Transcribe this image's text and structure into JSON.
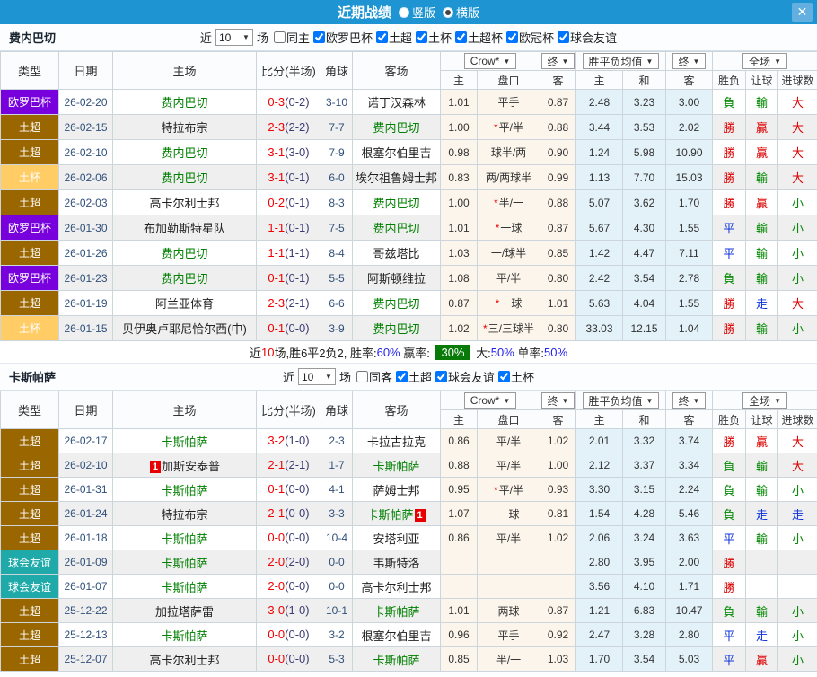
{
  "icons": {
    "dropdown_arrow": "▼",
    "close": "✕"
  },
  "titlebar": {
    "title": "近期战绩",
    "layout_options": [
      {
        "label": "竖版",
        "selected": false
      },
      {
        "label": "横版",
        "selected": true
      }
    ]
  },
  "columns": {
    "type": "类型",
    "date": "日期",
    "home": "主场",
    "score": "比分(半场)",
    "corner": "角球",
    "away": "客场",
    "dd_crown": "Crow*",
    "dd_final1": "终",
    "dd_avg": "胜平负均值",
    "dd_final2": "终",
    "dd_fullmatch": "全场",
    "sub_home": "主",
    "sub_line": "盘口",
    "sub_away": "客",
    "sub_avg_home": "主",
    "sub_avg_draw": "和",
    "sub_avg_away": "客",
    "sub_outcome": "胜负",
    "sub_handicap": "让球",
    "sub_goals": "进球数"
  },
  "league_colors": {
    "欧罗巴杯": "#7700DD",
    "土超": "#996600",
    "土杯": "#FFCC66",
    "球会友谊": "#1FA9A9",
    "欧冠杯": "#7700DD"
  },
  "result_colors": {
    "勝": "#DD0000",
    "贏": "#DD0000",
    "大": "#DD0000",
    "負": "#008800",
    "輸": "#008800",
    "小": "#008800",
    "平": "#1133DD",
    "走": "#1133DD"
  },
  "sections": [
    {
      "team": "费内巴切",
      "filter": {
        "near": "近",
        "count": "10",
        "unit": "场",
        "same": "同主",
        "same_checked": false,
        "leagues": [
          "欧罗巴杯",
          "土超",
          "土杯",
          "土超杯",
          "欧冠杯",
          "球会友谊"
        ]
      },
      "rows": [
        {
          "league": "欧罗巴杯",
          "date": "26-02-20",
          "home": "费内巴切",
          "home_focus": true,
          "score": "0-3",
          "half": "(0-2)",
          "corners": "3-10",
          "away": "诺丁汉森林",
          "away_focus": false,
          "ah_home": "1.01",
          "ah_star": false,
          "ah_line": "平手",
          "ah_away": "0.87",
          "avg_home": "2.48",
          "avg_draw": "3.23",
          "avg_away": "3.00",
          "outcome": "負",
          "ah_result": "輸",
          "goals_result": "大"
        },
        {
          "league": "土超",
          "date": "26-02-15",
          "home": "特拉布宗",
          "home_focus": false,
          "score": "2-3",
          "half": "(2-2)",
          "corners": "7-7",
          "away": "费内巴切",
          "away_focus": true,
          "ah_home": "1.00",
          "ah_star": true,
          "ah_line": "平/半",
          "ah_away": "0.88",
          "avg_home": "3.44",
          "avg_draw": "3.53",
          "avg_away": "2.02",
          "outcome": "勝",
          "ah_result": "贏",
          "goals_result": "大"
        },
        {
          "league": "土超",
          "date": "26-02-10",
          "home": "费内巴切",
          "home_focus": true,
          "score": "3-1",
          "half": "(3-0)",
          "corners": "7-9",
          "away": "根塞尔伯里吉",
          "away_focus": false,
          "ah_home": "0.98",
          "ah_star": false,
          "ah_line": "球半/两",
          "ah_away": "0.90",
          "avg_home": "1.24",
          "avg_draw": "5.98",
          "avg_away": "10.90",
          "outcome": "勝",
          "ah_result": "贏",
          "goals_result": "大"
        },
        {
          "league": "土杯",
          "date": "26-02-06",
          "home": "费内巴切",
          "home_focus": true,
          "score": "3-1",
          "half": "(0-1)",
          "corners": "6-0",
          "away": "埃尔祖鲁姆士邦",
          "away_focus": false,
          "ah_home": "0.83",
          "ah_star": false,
          "ah_line": "两/两球半",
          "ah_away": "0.99",
          "avg_home": "1.13",
          "avg_draw": "7.70",
          "avg_away": "15.03",
          "outcome": "勝",
          "ah_result": "輸",
          "goals_result": "大"
        },
        {
          "league": "土超",
          "date": "26-02-03",
          "home": "高卡尔利士邦",
          "home_focus": false,
          "score": "0-2",
          "half": "(0-1)",
          "corners": "8-3",
          "away": "费内巴切",
          "away_focus": true,
          "ah_home": "1.00",
          "ah_star": true,
          "ah_line": "半/一",
          "ah_away": "0.88",
          "avg_home": "5.07",
          "avg_draw": "3.62",
          "avg_away": "1.70",
          "outcome": "勝",
          "ah_result": "贏",
          "goals_result": "小"
        },
        {
          "league": "欧罗巴杯",
          "date": "26-01-30",
          "home": "布加勒斯特星队",
          "home_focus": false,
          "score": "1-1",
          "half": "(0-1)",
          "corners": "7-5",
          "away": "费内巴切",
          "away_focus": true,
          "ah_home": "1.01",
          "ah_star": true,
          "ah_line": "一球",
          "ah_away": "0.87",
          "avg_home": "5.67",
          "avg_draw": "4.30",
          "avg_away": "1.55",
          "outcome": "平",
          "ah_result": "輸",
          "goals_result": "小"
        },
        {
          "league": "土超",
          "date": "26-01-26",
          "home": "费内巴切",
          "home_focus": true,
          "score": "1-1",
          "half": "(1-1)",
          "corners": "8-4",
          "away": "哥兹塔比",
          "away_focus": false,
          "ah_home": "1.03",
          "ah_star": false,
          "ah_line": "一/球半",
          "ah_away": "0.85",
          "avg_home": "1.42",
          "avg_draw": "4.47",
          "avg_away": "7.11",
          "outcome": "平",
          "ah_result": "輸",
          "goals_result": "小"
        },
        {
          "league": "欧罗巴杯",
          "date": "26-01-23",
          "home": "费内巴切",
          "home_focus": true,
          "score": "0-1",
          "half": "(0-1)",
          "corners": "5-5",
          "away": "阿斯顿维拉",
          "away_focus": false,
          "ah_home": "1.08",
          "ah_star": false,
          "ah_line": "平/半",
          "ah_away": "0.80",
          "avg_home": "2.42",
          "avg_draw": "3.54",
          "avg_away": "2.78",
          "outcome": "負",
          "ah_result": "輸",
          "goals_result": "小"
        },
        {
          "league": "土超",
          "date": "26-01-19",
          "home": "阿兰亚体育",
          "home_focus": false,
          "score": "2-3",
          "half": "(2-1)",
          "corners": "6-6",
          "away": "费内巴切",
          "away_focus": true,
          "ah_home": "0.87",
          "ah_star": true,
          "ah_line": "一球",
          "ah_away": "1.01",
          "avg_home": "5.63",
          "avg_draw": "4.04",
          "avg_away": "1.55",
          "outcome": "勝",
          "ah_result": "走",
          "goals_result": "大"
        },
        {
          "league": "土杯",
          "date": "26-01-15",
          "home": "贝伊奥卢耶尼恰尔西(中)",
          "home_focus": false,
          "score": "0-1",
          "half": "(0-0)",
          "corners": "3-9",
          "away": "费内巴切",
          "away_focus": true,
          "ah_home": "1.02",
          "ah_star": true,
          "ah_line": "三/三球半",
          "ah_away": "0.80",
          "avg_home": "33.03",
          "avg_draw": "12.15",
          "avg_away": "1.04",
          "outcome": "勝",
          "ah_result": "輸",
          "goals_result": "小"
        }
      ],
      "summary": {
        "segments": [
          {
            "text": "近",
            "style": "dark"
          },
          {
            "text": "10",
            "style": "red"
          },
          {
            "text": "场,胜6平2负2, 胜率:",
            "style": "dark"
          },
          {
            "text": "60%",
            "style": "blue"
          },
          {
            "text": " 赢率: ",
            "style": "dark"
          },
          {
            "text": "30%",
            "style": "badge"
          },
          {
            "text": " 大:",
            "style": "dark"
          },
          {
            "text": "50%",
            "style": "blue"
          },
          {
            "text": " 单率:",
            "style": "dark"
          },
          {
            "text": "50%",
            "style": "blue"
          }
        ]
      }
    },
    {
      "team": "卡斯帕萨",
      "filter": {
        "near": "近",
        "count": "10",
        "unit": "场",
        "same": "同客",
        "same_checked": false,
        "leagues": [
          "土超",
          "球会友谊",
          "土杯"
        ]
      },
      "rows": [
        {
          "league": "土超",
          "date": "26-02-17",
          "home": "卡斯帕萨",
          "home_focus": true,
          "score": "3-2",
          "half": "(1-0)",
          "corners": "2-3",
          "away": "卡拉古拉克",
          "away_focus": false,
          "ah_home": "0.86",
          "ah_star": false,
          "ah_line": "平/半",
          "ah_away": "1.02",
          "avg_home": "2.01",
          "avg_draw": "3.32",
          "avg_away": "3.74",
          "outcome": "勝",
          "ah_result": "贏",
          "goals_result": "大"
        },
        {
          "league": "土超",
          "date": "26-02-10",
          "home": "加斯安泰普",
          "home_focus": false,
          "home_badge_pre": "1",
          "score": "2-1",
          "half": "(2-1)",
          "corners": "1-7",
          "away": "卡斯帕萨",
          "away_focus": true,
          "ah_home": "0.88",
          "ah_star": false,
          "ah_line": "平/半",
          "ah_away": "1.00",
          "avg_home": "2.12",
          "avg_draw": "3.37",
          "avg_away": "3.34",
          "outcome": "負",
          "ah_result": "輸",
          "goals_result": "大"
        },
        {
          "league": "土超",
          "date": "26-01-31",
          "home": "卡斯帕萨",
          "home_focus": true,
          "score": "0-1",
          "half": "(0-0)",
          "corners": "4-1",
          "away": "萨姆士邦",
          "away_focus": false,
          "ah_home": "0.95",
          "ah_star": true,
          "ah_line": "平/半",
          "ah_away": "0.93",
          "avg_home": "3.30",
          "avg_draw": "3.15",
          "avg_away": "2.24",
          "outcome": "負",
          "ah_result": "輸",
          "goals_result": "小"
        },
        {
          "league": "土超",
          "date": "26-01-24",
          "home": "特拉布宗",
          "home_focus": false,
          "score": "2-1",
          "half": "(0-0)",
          "corners": "3-3",
          "away": "卡斯帕萨",
          "away_focus": true,
          "away_badge_post": "1",
          "ah_home": "1.07",
          "ah_star": false,
          "ah_line": "一球",
          "ah_away": "0.81",
          "avg_home": "1.54",
          "avg_draw": "4.28",
          "avg_away": "5.46",
          "outcome": "負",
          "ah_result": "走",
          "goals_result": "走"
        },
        {
          "league": "土超",
          "date": "26-01-18",
          "home": "卡斯帕萨",
          "home_focus": true,
          "score": "0-0",
          "half": "(0-0)",
          "corners": "10-4",
          "away": "安塔利亚",
          "away_focus": false,
          "ah_home": "0.86",
          "ah_star": false,
          "ah_line": "平/半",
          "ah_away": "1.02",
          "avg_home": "2.06",
          "avg_draw": "3.24",
          "avg_away": "3.63",
          "outcome": "平",
          "ah_result": "輸",
          "goals_result": "小"
        },
        {
          "league": "球会友谊",
          "date": "26-01-09",
          "home": "卡斯帕萨",
          "home_focus": true,
          "score": "2-0",
          "half": "(2-0)",
          "corners": "0-0",
          "away": "韦斯特洛",
          "away_focus": false,
          "ah_home": "",
          "ah_star": false,
          "ah_line": "",
          "ah_away": "",
          "avg_home": "2.80",
          "avg_draw": "3.95",
          "avg_away": "2.00",
          "outcome": "勝",
          "ah_result": "",
          "goals_result": ""
        },
        {
          "league": "球会友谊",
          "date": "26-01-07",
          "home": "卡斯帕萨",
          "home_focus": true,
          "score": "2-0",
          "half": "(0-0)",
          "corners": "0-0",
          "away": "高卡尔利士邦",
          "away_focus": false,
          "ah_home": "",
          "ah_star": false,
          "ah_line": "",
          "ah_away": "",
          "avg_home": "3.56",
          "avg_draw": "4.10",
          "avg_away": "1.71",
          "outcome": "勝",
          "ah_result": "",
          "goals_result": ""
        },
        {
          "league": "土超",
          "date": "25-12-22",
          "home": "加拉塔萨雷",
          "home_focus": false,
          "score": "3-0",
          "half": "(1-0)",
          "corners": "10-1",
          "away": "卡斯帕萨",
          "away_focus": true,
          "ah_home": "1.01",
          "ah_star": false,
          "ah_line": "两球",
          "ah_away": "0.87",
          "avg_home": "1.21",
          "avg_draw": "6.83",
          "avg_away": "10.47",
          "outcome": "負",
          "ah_result": "輸",
          "goals_result": "小"
        },
        {
          "league": "土超",
          "date": "25-12-13",
          "home": "卡斯帕萨",
          "home_focus": true,
          "score": "0-0",
          "half": "(0-0)",
          "corners": "3-2",
          "away": "根塞尔伯里吉",
          "away_focus": false,
          "ah_home": "0.96",
          "ah_star": false,
          "ah_line": "平手",
          "ah_away": "0.92",
          "avg_home": "2.47",
          "avg_draw": "3.28",
          "avg_away": "2.80",
          "outcome": "平",
          "ah_result": "走",
          "goals_result": "小"
        },
        {
          "league": "土超",
          "date": "25-12-07",
          "home": "高卡尔利士邦",
          "home_focus": false,
          "score": "0-0",
          "half": "(0-0)",
          "corners": "5-3",
          "away": "卡斯帕萨",
          "away_focus": true,
          "ah_home": "0.85",
          "ah_star": false,
          "ah_line": "半/一",
          "ah_away": "1.03",
          "avg_home": "1.70",
          "avg_draw": "3.54",
          "avg_away": "5.03",
          "outcome": "平",
          "ah_result": "贏",
          "goals_result": "小"
        }
      ]
    }
  ]
}
